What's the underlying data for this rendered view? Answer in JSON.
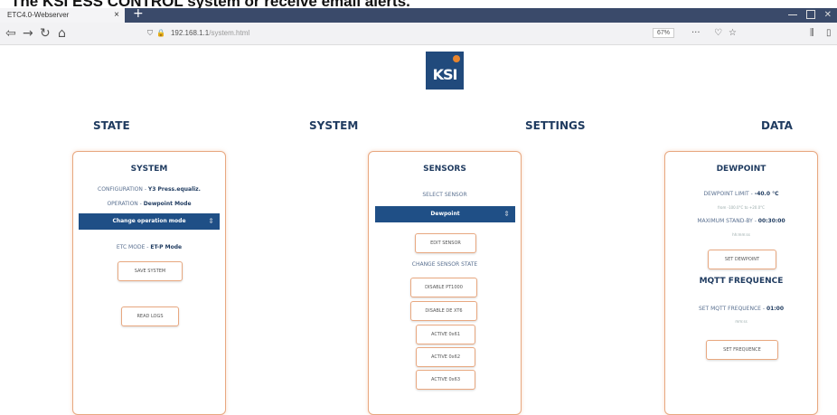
{
  "caption": "The KSI ESS CONTROL system or receive email alerts.",
  "browser": {
    "tab_title": "ETC4.0-Webserver",
    "tab_close": "×",
    "new_tab": "+",
    "url_host": "192.168.1.1",
    "url_path": "/system.html",
    "zoom": "67%",
    "more": "···"
  },
  "logo": {
    "text": "KSI"
  },
  "nav": {
    "state": "STATE",
    "system": "SYSTEM",
    "settings": "SETTINGS",
    "data": "DATA"
  },
  "system_card": {
    "title": "SYSTEM",
    "config_label": "CONFIGURATION -",
    "config_value": "Y3 Press.equaliz.",
    "operation_label": "OPERATION -",
    "operation_value": "Dewpoint Mode",
    "dropdown_value": "Change operation mode",
    "etc_mode_label": "ETC MODE -",
    "etc_mode_value": "ET-P Mode",
    "save_button": "SAVE SYSTEM",
    "read_logs_button": "READ LOGS"
  },
  "sensors_card": {
    "title": "SENSORS",
    "select_label": "SELECT SENSOR",
    "dropdown_value": "Dewpoint",
    "edit_button": "EDIT SENSOR",
    "change_state_label": "CHANGE SENSOR STATE",
    "buttons": [
      "DISABLE PT1000",
      "DISABLE DE XT6",
      "ACTIVE 0x61",
      "ACTIVE 0x62",
      "ACTIVE 0x63"
    ]
  },
  "data_card": {
    "title": "DEWPOINT",
    "limit_label": "DEWPOINT LIMIT -",
    "limit_value": "-40.0 °C",
    "limit_range": "from -100.0°C to +20.0°C",
    "standby_label": "MAXIMUM STAND-BY -",
    "standby_value": "00:30:00",
    "standby_unit": "hh:mm:ss",
    "set_dewpoint_button": "SET DEWPOINT",
    "mqtt_title": "MQTT FREQUENCE",
    "mqtt_label": "SET MQTT FREQUENCE -",
    "mqtt_value": "01:00",
    "mqtt_unit": "mm:ss",
    "set_frequence_button": "SET FREQUENCE"
  }
}
